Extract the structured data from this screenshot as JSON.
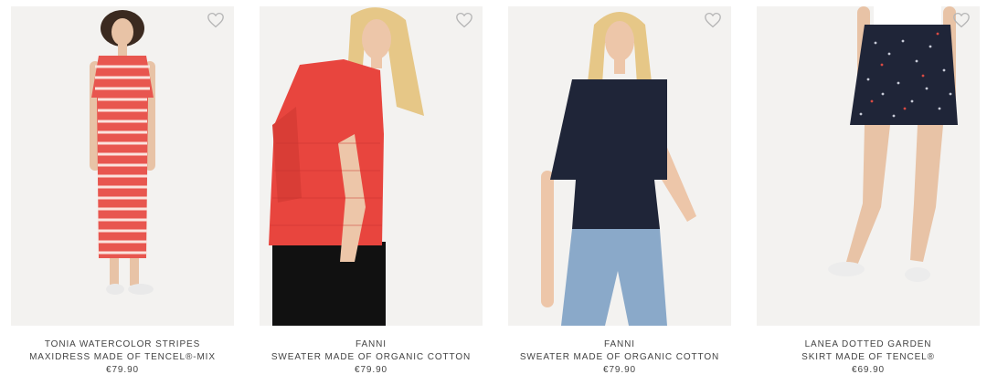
{
  "products": [
    {
      "name_line1": "TONIA WATERCOLOR STRIPES",
      "name_line2": "MAXIDRESS MADE OF TENCEL®-MIX",
      "price": "€79.90",
      "wishlist_icon": "heart-outline-icon",
      "image": "model-red-striped-maxidress"
    },
    {
      "name_line1": "FANNI",
      "name_line2": "SWEATER MADE OF ORGANIC COTTON",
      "price": "€79.90",
      "wishlist_icon": "heart-outline-icon",
      "image": "model-red-knit-sweater"
    },
    {
      "name_line1": "FANNI",
      "name_line2": "SWEATER MADE OF ORGANIC COTTON",
      "price": "€79.90",
      "wishlist_icon": "heart-outline-icon",
      "image": "model-navy-knit-sweater"
    },
    {
      "name_line1": "LANEA DOTTED GARDEN",
      "name_line2": "SKIRT MADE OF TENCEL®",
      "price": "€69.90",
      "wishlist_icon": "heart-outline-icon",
      "image": "model-navy-dotted-skirt"
    }
  ],
  "colors": {
    "background": "#ffffff",
    "image_background": "#f3f2f0",
    "text": "#444444",
    "heart_outline": "#b5b5b5",
    "coral": "#e8564f",
    "navy": "#1f2538",
    "denim": "#8aa9c9"
  }
}
